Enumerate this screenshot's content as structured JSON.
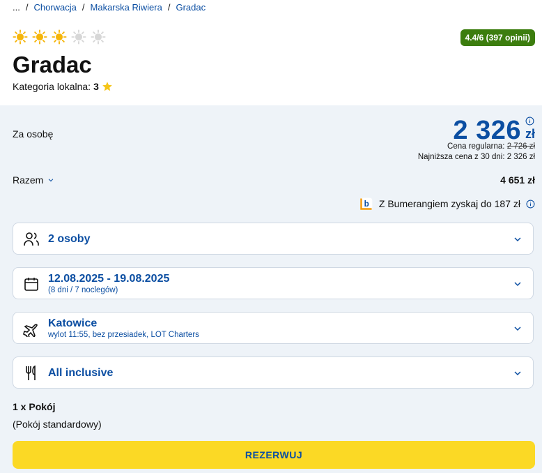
{
  "breadcrumb": {
    "ellipsis": "...",
    "items": [
      "Chorwacja",
      "Makarska Riwiera",
      "Gradac"
    ]
  },
  "hotel": {
    "suns_total": 5,
    "suns_filled": 3,
    "rating_badge": "4.4/6 (397 opinii)",
    "name": "Gradac",
    "category_label": "Kategoria lokalna:",
    "category_value": "3"
  },
  "pricing": {
    "per_person_label": "Za osobę",
    "price": "2 326",
    "currency": "zł",
    "regular_label": "Cena regularna:",
    "regular_value": "2 726 zł",
    "lowest_label": "Najniższa cena z 30 dni:",
    "lowest_value": "2 326 zł",
    "total_label": "Razem",
    "total_value": "4 651 zł",
    "bumerang_text": "Z Bumerangiem zyskaj do 187 zł"
  },
  "options": {
    "persons": {
      "label": "2 osoby"
    },
    "dates": {
      "label": "12.08.2025 - 19.08.2025",
      "sub": "(8 dni / 7 noclegów)"
    },
    "flight": {
      "label": "Katowice",
      "sub": "wylot 11:55, bez przesiadek, LOT Charters"
    },
    "board": {
      "label": "All inclusive"
    }
  },
  "room": {
    "title": "1 x Pokój",
    "type": "(Pokój standardowy)"
  },
  "actions": {
    "reserve_label": "REZERWUJ"
  },
  "colors": {
    "brand_blue": "#0b4ea2",
    "rating_green": "#3c7d0e",
    "reserve_yellow": "#fbd925",
    "panel_bg": "#eef3f8",
    "sun_active": "#f5b50a",
    "sun_inactive": "#d7d7d7"
  },
  "icons": [
    "sun-icon",
    "star-icon",
    "info-icon",
    "chevron-down-icon",
    "bumerang-logo-icon",
    "people-icon",
    "calendar-icon",
    "plane-icon",
    "cutlery-icon"
  ]
}
